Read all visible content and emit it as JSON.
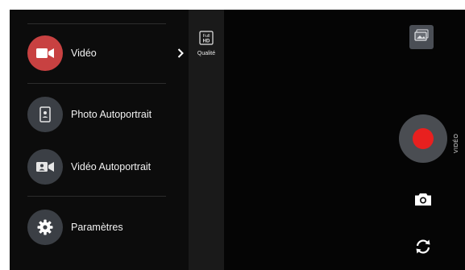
{
  "menu": {
    "items": [
      {
        "id": "video",
        "label": "Vidéo",
        "icon": "video-camera-icon",
        "active": true
      },
      {
        "id": "photo-selfie",
        "label": "Photo Autoportrait",
        "icon": "phone-portrait-icon"
      },
      {
        "id": "video-selfie",
        "label": "Vidéo Autoportrait",
        "icon": "video-selfie-icon"
      },
      {
        "id": "settings",
        "label": "Paramètres",
        "icon": "gear-icon"
      }
    ]
  },
  "quality": {
    "label": "Qualité",
    "badge": "Full HD"
  },
  "camera": {
    "mode_label": "VIDÉO"
  },
  "colors": {
    "accent_active": "#c84141",
    "record": "#e8201f",
    "icon_bg": "#3b3f45"
  }
}
